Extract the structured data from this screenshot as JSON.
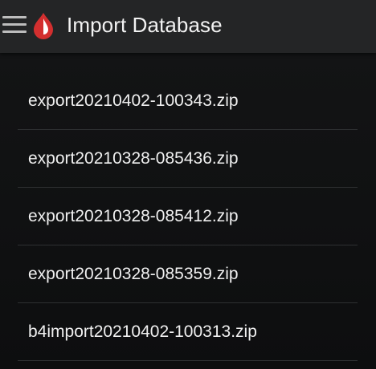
{
  "header": {
    "title": "Import Database",
    "menu_icon": "menu-icon",
    "app_icon": "blood-drop-icon",
    "app_icon_color": "#d32f2f"
  },
  "files": [
    {
      "name": "export20210402-100343.zip"
    },
    {
      "name": "export20210328-085436.zip"
    },
    {
      "name": "export20210328-085412.zip"
    },
    {
      "name": "export20210328-085359.zip"
    },
    {
      "name": "b4import20210402-100313.zip"
    }
  ],
  "colors": {
    "toolbar": "#242526",
    "background": "#121314",
    "divider": "#2e3032",
    "text": "#f0f0f0"
  }
}
